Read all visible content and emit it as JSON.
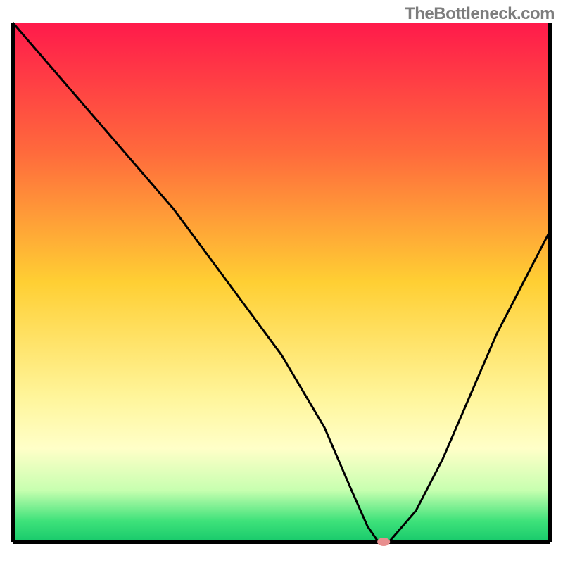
{
  "watermark": "TheBottleneck.com",
  "chart_data": {
    "type": "line",
    "title": "",
    "xlabel": "",
    "ylabel": "",
    "xlim": [
      0,
      100
    ],
    "ylim": [
      0,
      100
    ],
    "background_gradient_stops": [
      {
        "offset": 0,
        "color": "#ff1a4b"
      },
      {
        "offset": 25,
        "color": "#ff6a3c"
      },
      {
        "offset": 50,
        "color": "#ffcf33"
      },
      {
        "offset": 72,
        "color": "#fff59a"
      },
      {
        "offset": 82,
        "color": "#ffffc8"
      },
      {
        "offset": 90,
        "color": "#c8ffb0"
      },
      {
        "offset": 96,
        "color": "#3ee27a"
      },
      {
        "offset": 100,
        "color": "#17c96b"
      }
    ],
    "series": [
      {
        "name": "bottleneck-curve",
        "color": "#000000",
        "width": 3,
        "x": [
          0,
          10,
          20,
          30,
          40,
          50,
          58,
          63,
          66,
          68,
          70,
          75,
          80,
          85,
          90,
          95,
          100
        ],
        "y": [
          100,
          88,
          76,
          64,
          50,
          36,
          22,
          10,
          3,
          0,
          0,
          6,
          16,
          28,
          40,
          50,
          60
        ]
      }
    ],
    "marker": {
      "name": "optimal-point",
      "x": 69,
      "y": 0,
      "rx": 9,
      "ry": 6,
      "color": "#e88f8f"
    },
    "axes": {
      "left": {
        "x": 2,
        "y1": 0,
        "y2": 100
      },
      "bottom": {
        "y": 0,
        "x1": 0,
        "x2": 100
      },
      "right": {
        "x": 100,
        "y1": 0,
        "y2": 100
      }
    }
  }
}
